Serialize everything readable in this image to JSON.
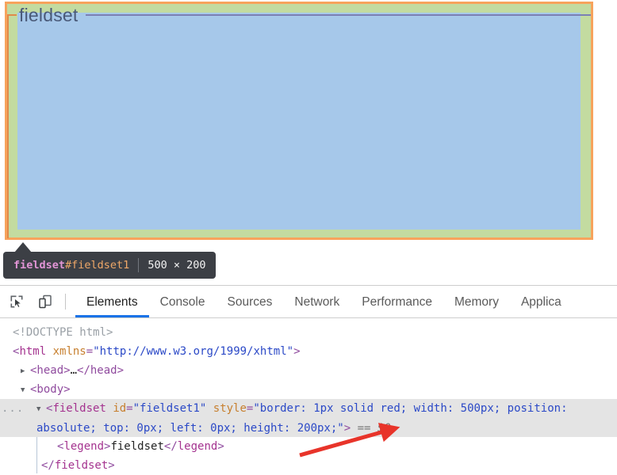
{
  "viewport": {
    "legend_text": "fieldset",
    "highlight": {
      "border_color": "#f7a35c",
      "padding_color": "#c3dba0",
      "content_color": "#a6c8ea",
      "element_border_color": "#e08a4a"
    }
  },
  "inspect_tooltip": {
    "tag_name": "fieldset",
    "element_id": "#fieldset1",
    "dimensions": "500 × 200",
    "background": "#3c3f45",
    "tag_color": "#e295d6",
    "id_color": "#f0a868"
  },
  "devtools": {
    "toolbar_icons": [
      {
        "name": "inspect-element-icon",
        "title": "Inspect element"
      },
      {
        "name": "device-toolbar-icon",
        "title": "Toggle device toolbar"
      }
    ],
    "tabs": [
      {
        "label": "Elements",
        "active": true
      },
      {
        "label": "Console",
        "active": false
      },
      {
        "label": "Sources",
        "active": false
      },
      {
        "label": "Network",
        "active": false
      },
      {
        "label": "Performance",
        "active": false
      },
      {
        "label": "Memory",
        "active": false
      },
      {
        "label": "Applica",
        "active": false
      }
    ],
    "active_tab_underline_color": "#1a73e8"
  },
  "dom_tree": {
    "doctype": "<!DOCTYPE html>",
    "html_open": {
      "lt": "<",
      "tag": "html",
      "attr_name": "xmlns",
      "eq": "=",
      "attr_value": "\"http://www.w3.org/1999/xhtml\"",
      "gt": ">"
    },
    "head_row": {
      "twisty": "▶",
      "open": "<head>",
      "ellipsis": "…",
      "close": "</head>"
    },
    "body_row": {
      "twisty": "▼",
      "open": "<body>"
    },
    "fieldset_row": {
      "ellipsis_badge": "...",
      "twisty": "▼",
      "lt": "<",
      "tag": "fieldset",
      "attr1_name": "id",
      "attr1_value": "\"fieldset1\"",
      "attr2_name": "style",
      "attr2_value": "\"border: 1px solid red; width: 500px; position: absolute; top: 0px; left: 0px; height: 200px;\"",
      "gt": ">",
      "selected_ref": "== $0"
    },
    "legend_row": {
      "open_lt": "<",
      "open_tag": "legend",
      "open_gt": ">",
      "text": "fieldset",
      "close_lt": "</",
      "close_tag": "legend",
      "close_gt": ">"
    },
    "fieldset_close_row": {
      "lt": "</",
      "tag": "fieldset",
      "gt": ">"
    }
  },
  "annotation": {
    "arrow_color": "#e8342a",
    "points_to": "height: 200px"
  }
}
